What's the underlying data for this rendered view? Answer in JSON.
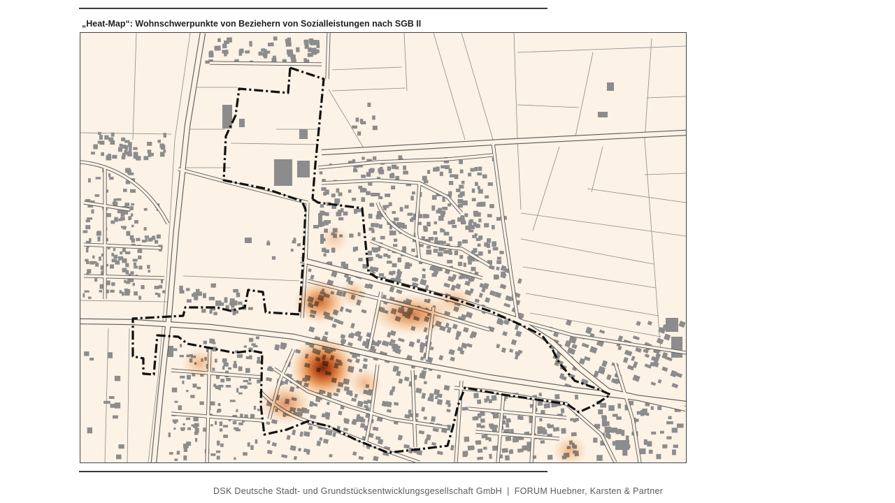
{
  "slide": {
    "title": "„Heat-Map“: Wohnschwerpunkte von Beziehern von Sozialleistungen nach SGB II",
    "footer": {
      "left": "DSK Deutsche Stadt- und Grundstücksentwicklungsgesellschaft GmbH",
      "separator": "|",
      "right": "FORUM Huebner, Karsten & Partner"
    }
  },
  "map": {
    "type": "heat-map over cadastral base map",
    "colors": {
      "background": "#fcf2e6",
      "streets": "#5a5a5a",
      "parcels": "#8a8a8a",
      "buildings": "#8c8c8c",
      "boundary": "#111111",
      "heat_core": "#6e1e00",
      "heat_mid": "#e27a2a",
      "heat_edge": "#f4be86"
    }
  }
}
